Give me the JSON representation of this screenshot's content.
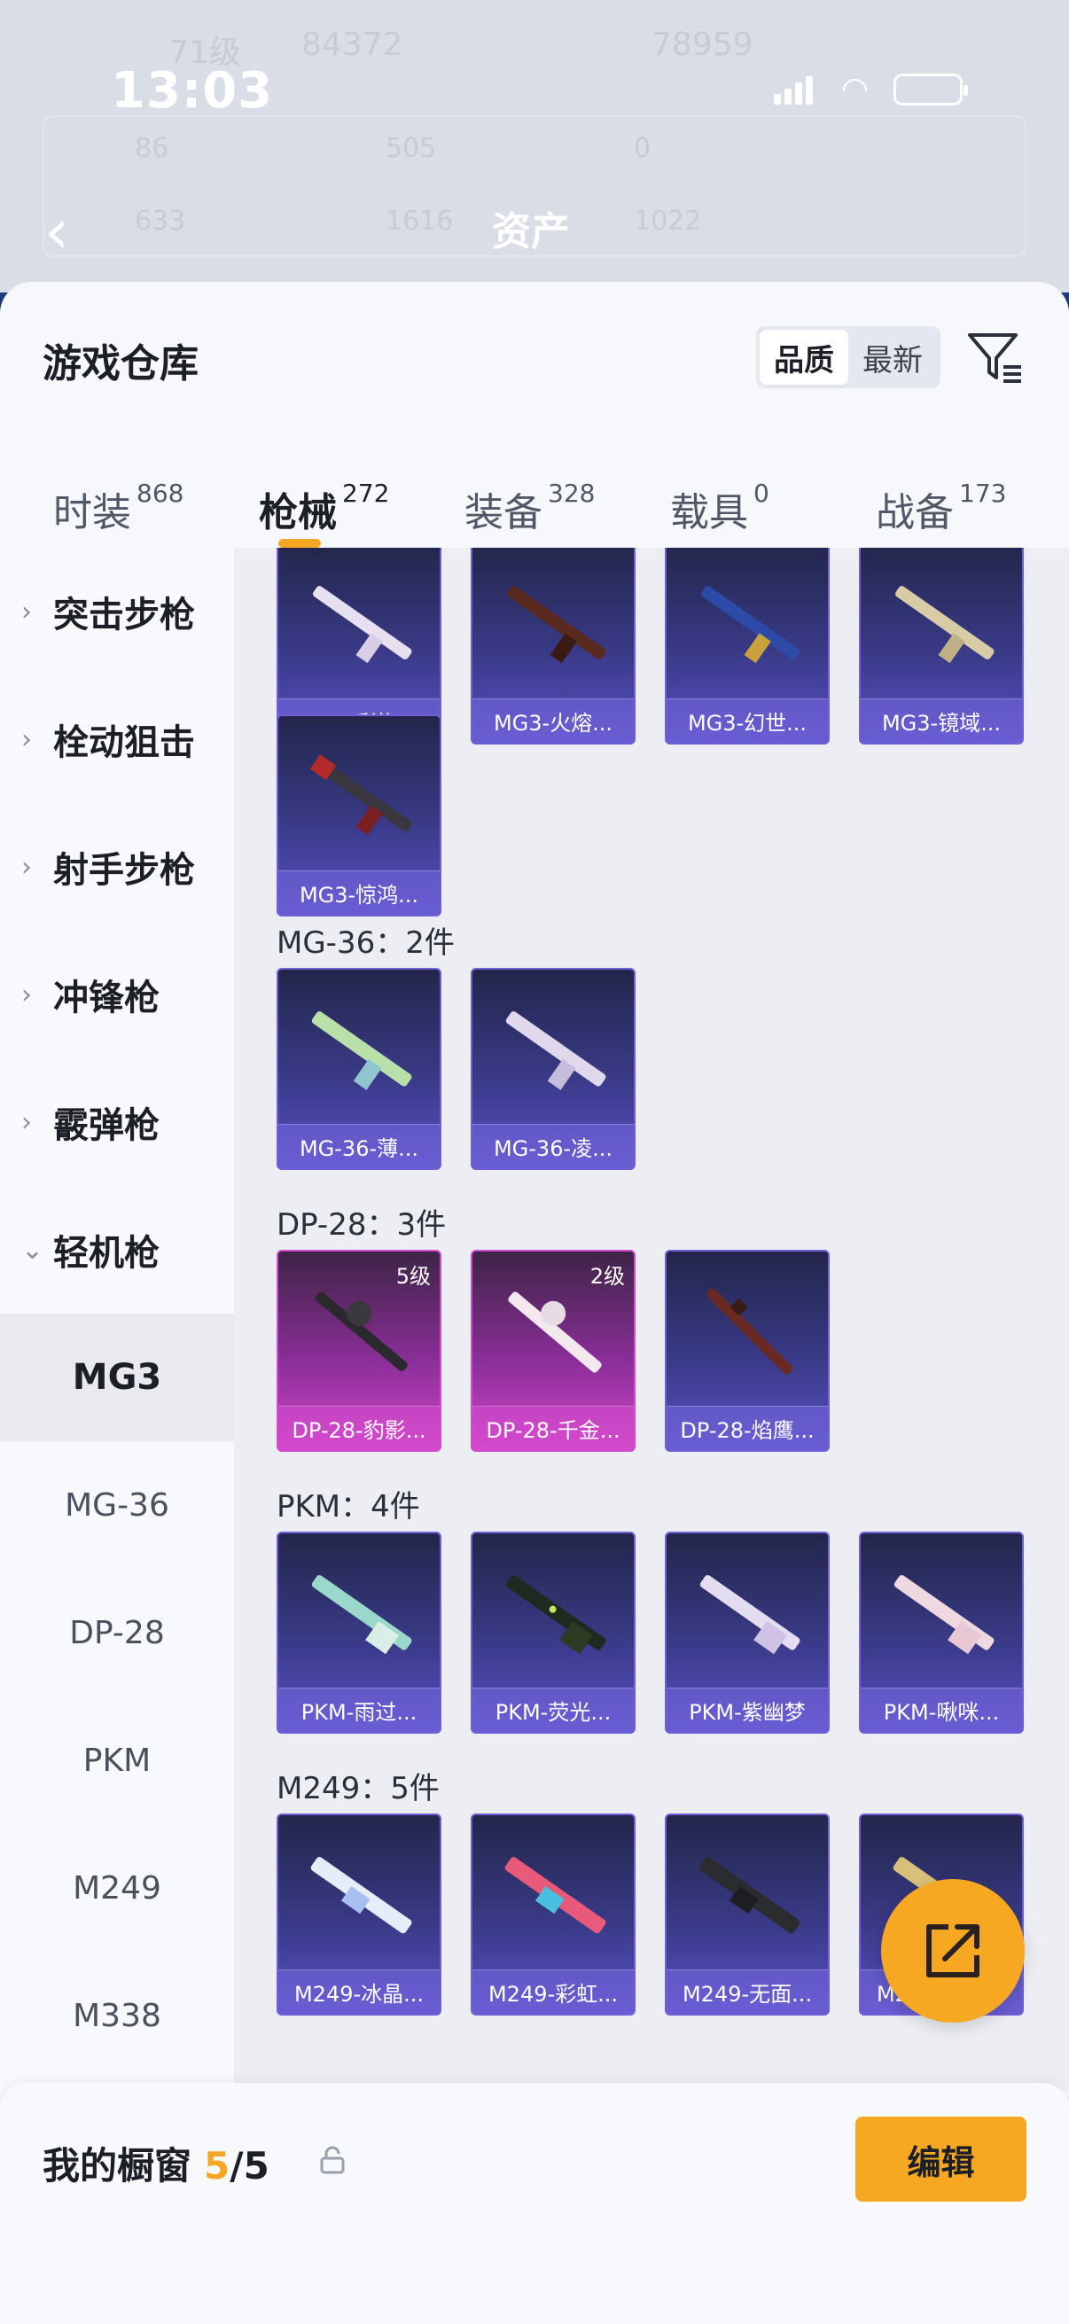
{
  "status_bar": {
    "time": "13:03"
  },
  "background_header": {
    "title": "资产",
    "level": "71级",
    "value_a": "84372",
    "value_b": "78959",
    "stats": [
      "86",
      "505",
      "0",
      "633",
      "1616",
      "1022"
    ]
  },
  "sheet": {
    "title": "游戏仓库",
    "sort": {
      "options": [
        "品质",
        "最新"
      ],
      "active": "品质"
    },
    "tabs": [
      {
        "label": "时装",
        "count": "868"
      },
      {
        "label": "枪械",
        "count": "272"
      },
      {
        "label": "装备",
        "count": "328"
      },
      {
        "label": "载具",
        "count": "0"
      },
      {
        "label": "战备",
        "count": "173"
      }
    ],
    "active_tab": "枪械"
  },
  "sidebar": {
    "categories": [
      "突击步枪",
      "栓动狙击",
      "射手步枪",
      "冲锋枪",
      "霰弹枪",
      "轻机枪"
    ],
    "expanded": "轻机枪",
    "sub_items": [
      "MG3",
      "MG-36",
      "DP-28",
      "PKM",
      "M249",
      "M338"
    ],
    "active_sub": "MG3"
  },
  "groups": [
    {
      "title": "",
      "items": [
        "MG3-彩旗...",
        "MG3-火熔...",
        "MG3-幻世...",
        "MG3-镜域...",
        "MG3-惊鸿..."
      ]
    },
    {
      "title": "MG-36：2件",
      "items": [
        "MG-36-薄...",
        "MG-36-凌..."
      ]
    },
    {
      "title": "DP-28：3件",
      "items": [
        "DP-28-豹影...",
        "DP-28-千金...",
        "DP-28-焰鹰..."
      ],
      "levels": [
        "5级",
        "2级",
        ""
      ]
    },
    {
      "title": "PKM：4件",
      "items": [
        "PKM-雨过...",
        "PKM-荧光...",
        "PKM-紫幽梦",
        "PKM-啾咪..."
      ]
    },
    {
      "title": "M249：5件",
      "items": [
        "M249-冰晶...",
        "M249-彩虹...",
        "M249-无面...",
        "M249-金丰..."
      ]
    }
  ],
  "bottom_bar": {
    "label": "我的橱窗",
    "used": "5",
    "total": "/5",
    "edit": "编辑"
  },
  "colors": {
    "accent": "#f5a623",
    "card_purple": "#5850c4",
    "card_pink": "#d145c9"
  }
}
